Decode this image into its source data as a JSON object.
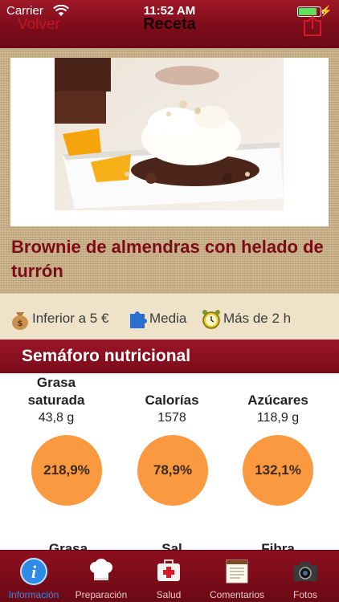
{
  "status_bar": {
    "carrier": "Carrier",
    "time": "11:52 AM"
  },
  "nav": {
    "back_label": "Volver",
    "title": "Receta"
  },
  "recipe": {
    "title": "Brownie de almendras con helado de turrón",
    "price": "Inferior a 5 €",
    "difficulty": "Media",
    "time": "Más de 2 h"
  },
  "nutrition": {
    "section_title": "Semáforo nutricional",
    "color": "#fa993f",
    "items": [
      {
        "name": "Grasa saturada",
        "amount": "43,8 g",
        "percent": "218,9%"
      },
      {
        "name": "Calorías",
        "amount": "1578",
        "percent": "78,9%"
      },
      {
        "name": "Azúcares",
        "amount": "118,9 g",
        "percent": "132,1%"
      }
    ],
    "next_row": [
      {
        "name": "Grasa"
      },
      {
        "name": "Sal"
      },
      {
        "name": "Fibra"
      }
    ]
  },
  "tabs": [
    {
      "label": "Información",
      "icon": "info-icon",
      "active": true
    },
    {
      "label": "Preparación",
      "icon": "chef-hat-icon",
      "active": false
    },
    {
      "label": "Salud",
      "icon": "first-aid-kit-icon",
      "active": false
    },
    {
      "label": "Comentarios",
      "icon": "notepad-icon",
      "active": false
    },
    {
      "label": "Fotos",
      "icon": "camera-icon",
      "active": false
    }
  ]
}
